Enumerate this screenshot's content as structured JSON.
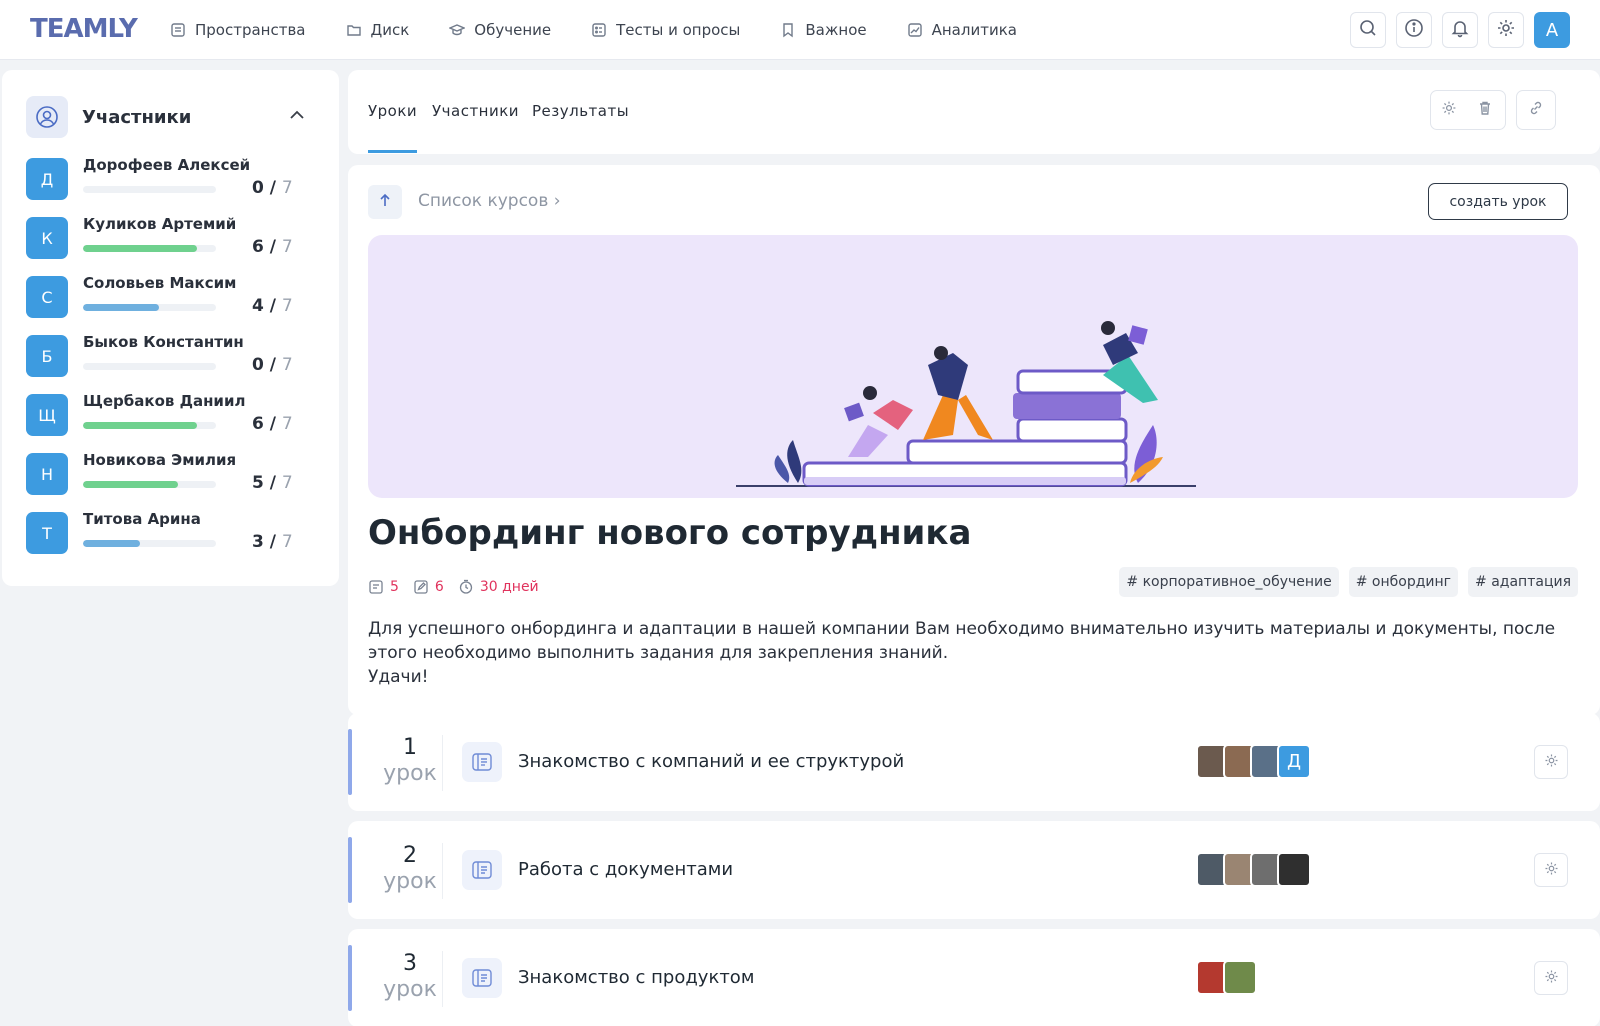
{
  "app": {
    "logo": "TEAMLY",
    "user_initial": "А"
  },
  "nav": [
    {
      "label": "Пространства",
      "icon": "spaces-icon"
    },
    {
      "label": "Диск",
      "icon": "folder-icon"
    },
    {
      "label": "Обучение",
      "icon": "graduation-icon"
    },
    {
      "label": "Тесты и опросы",
      "icon": "tests-icon"
    },
    {
      "label": "Важное",
      "icon": "bookmark-icon"
    },
    {
      "label": "Аналитика",
      "icon": "analytics-icon"
    }
  ],
  "participants": {
    "title": "Участники",
    "items": [
      {
        "initial": "Д",
        "name": "Дорофеев Алексей",
        "done": "0",
        "total": "7",
        "progress": 0,
        "color": "#8fb9e8"
      },
      {
        "initial": "К",
        "name": "Куликов Артемий",
        "done": "6",
        "total": "7",
        "progress": 0.857,
        "color": "#6fd18e"
      },
      {
        "initial": "С",
        "name": "Соловьев Максим",
        "done": "4",
        "total": "7",
        "progress": 0.571,
        "color": "#6fb0df"
      },
      {
        "initial": "Б",
        "name": "Быков Константин",
        "done": "0",
        "total": "7",
        "progress": 0,
        "color": "#8fb9e8"
      },
      {
        "initial": "Щ",
        "name": "Щербаков Даниил",
        "done": "6",
        "total": "7",
        "progress": 0.857,
        "color": "#6fd18e"
      },
      {
        "initial": "Н",
        "name": "Новикова Эмилия",
        "done": "5",
        "total": "7",
        "progress": 0.714,
        "color": "#6fd18e"
      },
      {
        "initial": "Т",
        "name": "Титова Арина",
        "done": "3",
        "total": "7",
        "progress": 0.428,
        "color": "#6fb0df"
      }
    ]
  },
  "tabs": [
    "Уроки",
    "Участники",
    "Результаты"
  ],
  "course": {
    "breadcrumb": "Список курсов",
    "create_button": "создать урок",
    "title": "Онбординг нового сотрудника",
    "lessons_count": "5",
    "tasks_count": "6",
    "duration": "30 дней",
    "tags": [
      "# корпоративное_обучение",
      "# онбординг",
      "# адаптация"
    ],
    "description_1": "Для успешного онбординга и адаптации в нашей компании Вам необходимо внимательно изучить материалы и документы, после этого необходимо выполнить задания для закрепления знаний.",
    "description_2": "Удачи!"
  },
  "lessons": [
    {
      "number": "1",
      "word": "урок",
      "title": "Знакомство с компаний и ее структурой",
      "extra_initial": "Д"
    },
    {
      "number": "2",
      "word": "урок",
      "title": "Работа с документами"
    },
    {
      "number": "3",
      "word": "урок",
      "title": "Знакомство с продуктом"
    }
  ]
}
